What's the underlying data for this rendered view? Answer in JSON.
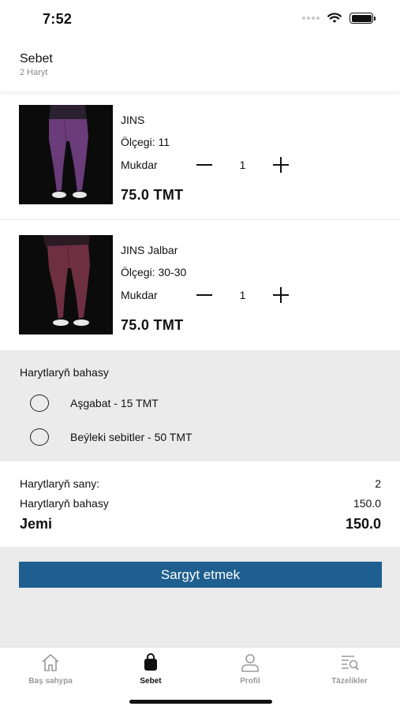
{
  "status_bar": {
    "time": "7:52"
  },
  "header": {
    "title": "Sebet",
    "subtitle": "2 Haryt"
  },
  "cart_items": [
    {
      "name": "JINS",
      "size": "Ölçegi: 11",
      "qty_label": "Mukdar",
      "qty": "1",
      "price": "75.0 TMT",
      "pants_color": "#6a3c7a"
    },
    {
      "name": "JINS Jalbar",
      "size": "Ölçegi: 30-30",
      "qty_label": "Mukdar",
      "qty": "1",
      "price": "75.0 TMT",
      "pants_color": "#6e2f43"
    }
  ],
  "delivery": {
    "title": "Harytlaryň bahasy",
    "options": [
      {
        "label": "Aşgabat - 15 TMT",
        "selected": false
      },
      {
        "label": "Beýleki sebitler - 50 TMT",
        "selected": false
      }
    ]
  },
  "summary": {
    "count_label": "Harytlaryň sany:",
    "count_value": "2",
    "price_label": "Harytlaryň bahasy",
    "price_value": "150.0",
    "total_label": "Jemi",
    "total_value": "150.0"
  },
  "order_button": {
    "label": "Sargyt etmek"
  },
  "tabbar": {
    "tabs": [
      {
        "label": "Baş sahypa",
        "icon": "home-icon",
        "active": false
      },
      {
        "label": "Sebet",
        "icon": "bag-icon",
        "active": true
      },
      {
        "label": "Profil",
        "icon": "person-icon",
        "active": false
      },
      {
        "label": "Täzelikler",
        "icon": "news-search-icon",
        "active": false
      }
    ]
  },
  "colors": {
    "accent": "#1e5f8f",
    "panel_bg": "#ebebeb",
    "inactive_tab": "#9a9a9a"
  }
}
